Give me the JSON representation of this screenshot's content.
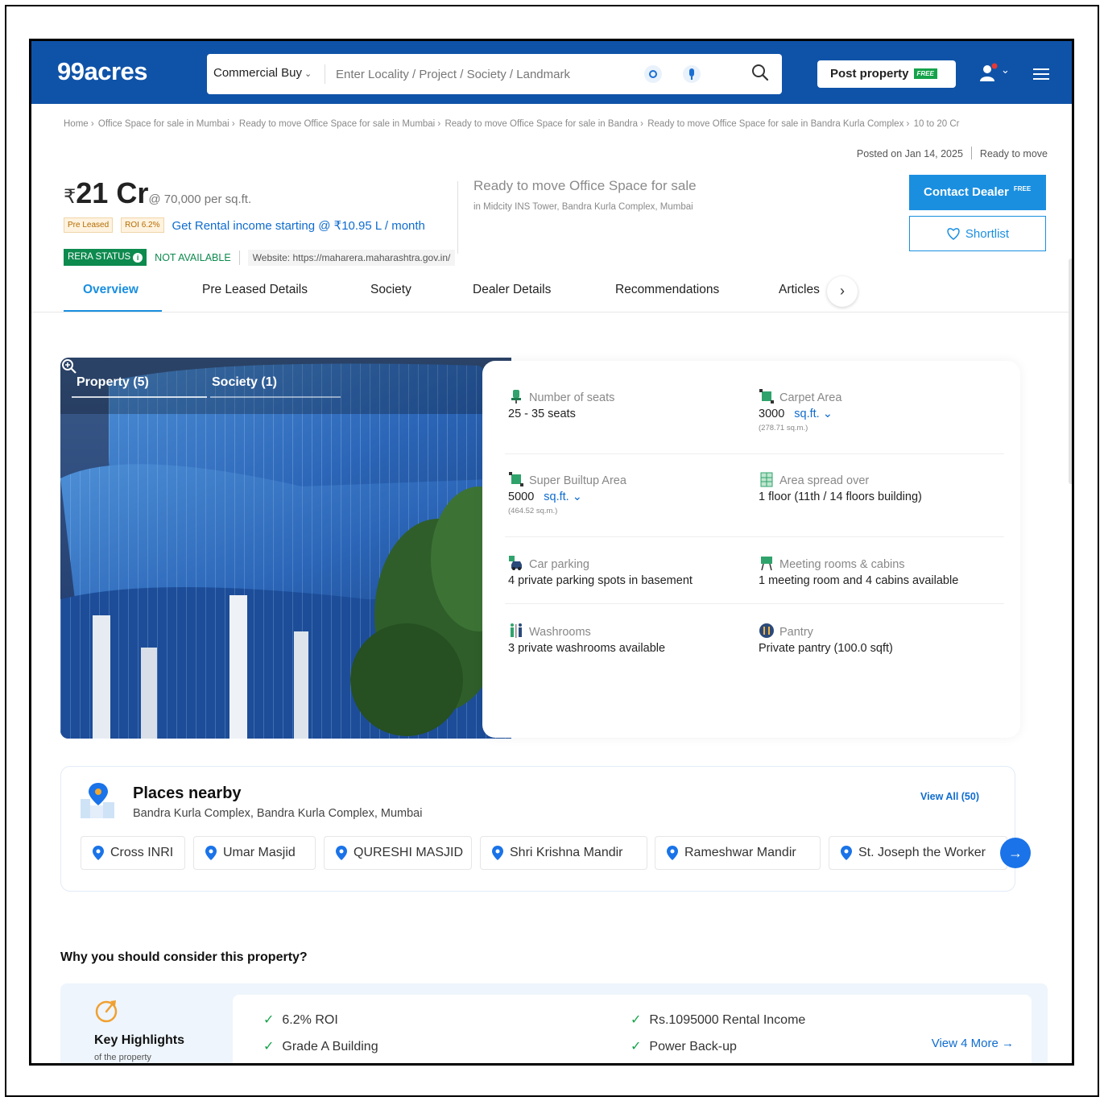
{
  "header": {
    "logo": "99acres",
    "search": {
      "category": "Commercial Buy",
      "placeholder": "Enter Locality / Project / Society / Landmark"
    },
    "post_property": "Post property",
    "free_tag": "FREE"
  },
  "breadcrumb": [
    "Home ›",
    "Office Space for sale in Mumbai ›",
    "Ready to move Office Space for sale in Mumbai ›",
    "Ready to move Office Space for sale in Bandra ›",
    "Ready to move Office Space for sale in Bandra Kurla Complex ›",
    "10 to 20 Cr"
  ],
  "posted": {
    "date": "Posted on Jan 14, 2025",
    "status": "Ready to move"
  },
  "price": {
    "currency": "₹",
    "value": "21 Cr",
    "per_sqft": "@ 70,000 per sq.ft."
  },
  "tags": [
    "Pre Leased",
    "ROI 6.2%"
  ],
  "rental_income": "Get Rental income starting @ ₹10.95 L / month",
  "rera": {
    "label": "RERA STATUS",
    "info": "i",
    "status": "NOT AVAILABLE",
    "website": "Website: https://maharera.maharashtra.gov.in/"
  },
  "property": {
    "title": "Ready to move Office Space for sale",
    "address": "in Midcity INS Tower, Bandra Kurla Complex, Mumbai"
  },
  "actions": {
    "contact": "Contact Dealer",
    "contact_tag": "FREE",
    "shortlist": "Shortlist"
  },
  "tabs": [
    "Overview",
    "Pre Leased Details",
    "Society",
    "Dealer Details",
    "Recommendations",
    "Articles"
  ],
  "tabs_next": "›",
  "gallery": {
    "tab_property": "Property (5)",
    "tab_society": "Society (1)"
  },
  "details": {
    "seats": {
      "label": "Number of seats",
      "value": "25 - 35 seats"
    },
    "carpet": {
      "label": "Carpet Area",
      "value": "3000",
      "unit": "sq.ft.",
      "sub": "(278.71 sq.m.)"
    },
    "super_builtup": {
      "label": "Super Builtup Area",
      "value": "5000",
      "unit": "sq.ft.",
      "sub": "(464.52 sq.m.)"
    },
    "area_spread": {
      "label": "Area spread over",
      "value": "1 floor (11th / 14 floors building)"
    },
    "parking": {
      "label": "Car parking",
      "value": "4 private parking spots in basement"
    },
    "meeting": {
      "label": "Meeting rooms & cabins",
      "value": "1 meeting room and 4 cabins available"
    },
    "washrooms": {
      "label": "Washrooms",
      "value": "3 private washrooms available"
    },
    "pantry": {
      "label": "Pantry",
      "value": "Private pantry (100.0 sqft)"
    }
  },
  "places": {
    "title": "Places nearby",
    "subtitle": "Bandra Kurla Complex, Bandra Kurla Complex, Mumbai",
    "view_all": "View All (50)",
    "items": [
      "Cross INRI",
      "Umar Masjid",
      "QURESHI MASJID",
      "Shri Krishna Mandir",
      "Rameshwar Mandir",
      "St. Joseph the Worker"
    ],
    "next": "→"
  },
  "why": {
    "title": "Why you should consider this property?",
    "key_highlights": "Key Highlights",
    "key_highlights_sub": "of the property",
    "highlights": [
      "6.2% ROI",
      "Grade A Building",
      "Rs.1095000 Rental Income",
      "Power Back-up"
    ],
    "view_more": "View 4 More →"
  },
  "colors": {
    "brand": "#0f53a8",
    "accent": "#1a8fe0",
    "rera_green": "#0d8a4e"
  }
}
